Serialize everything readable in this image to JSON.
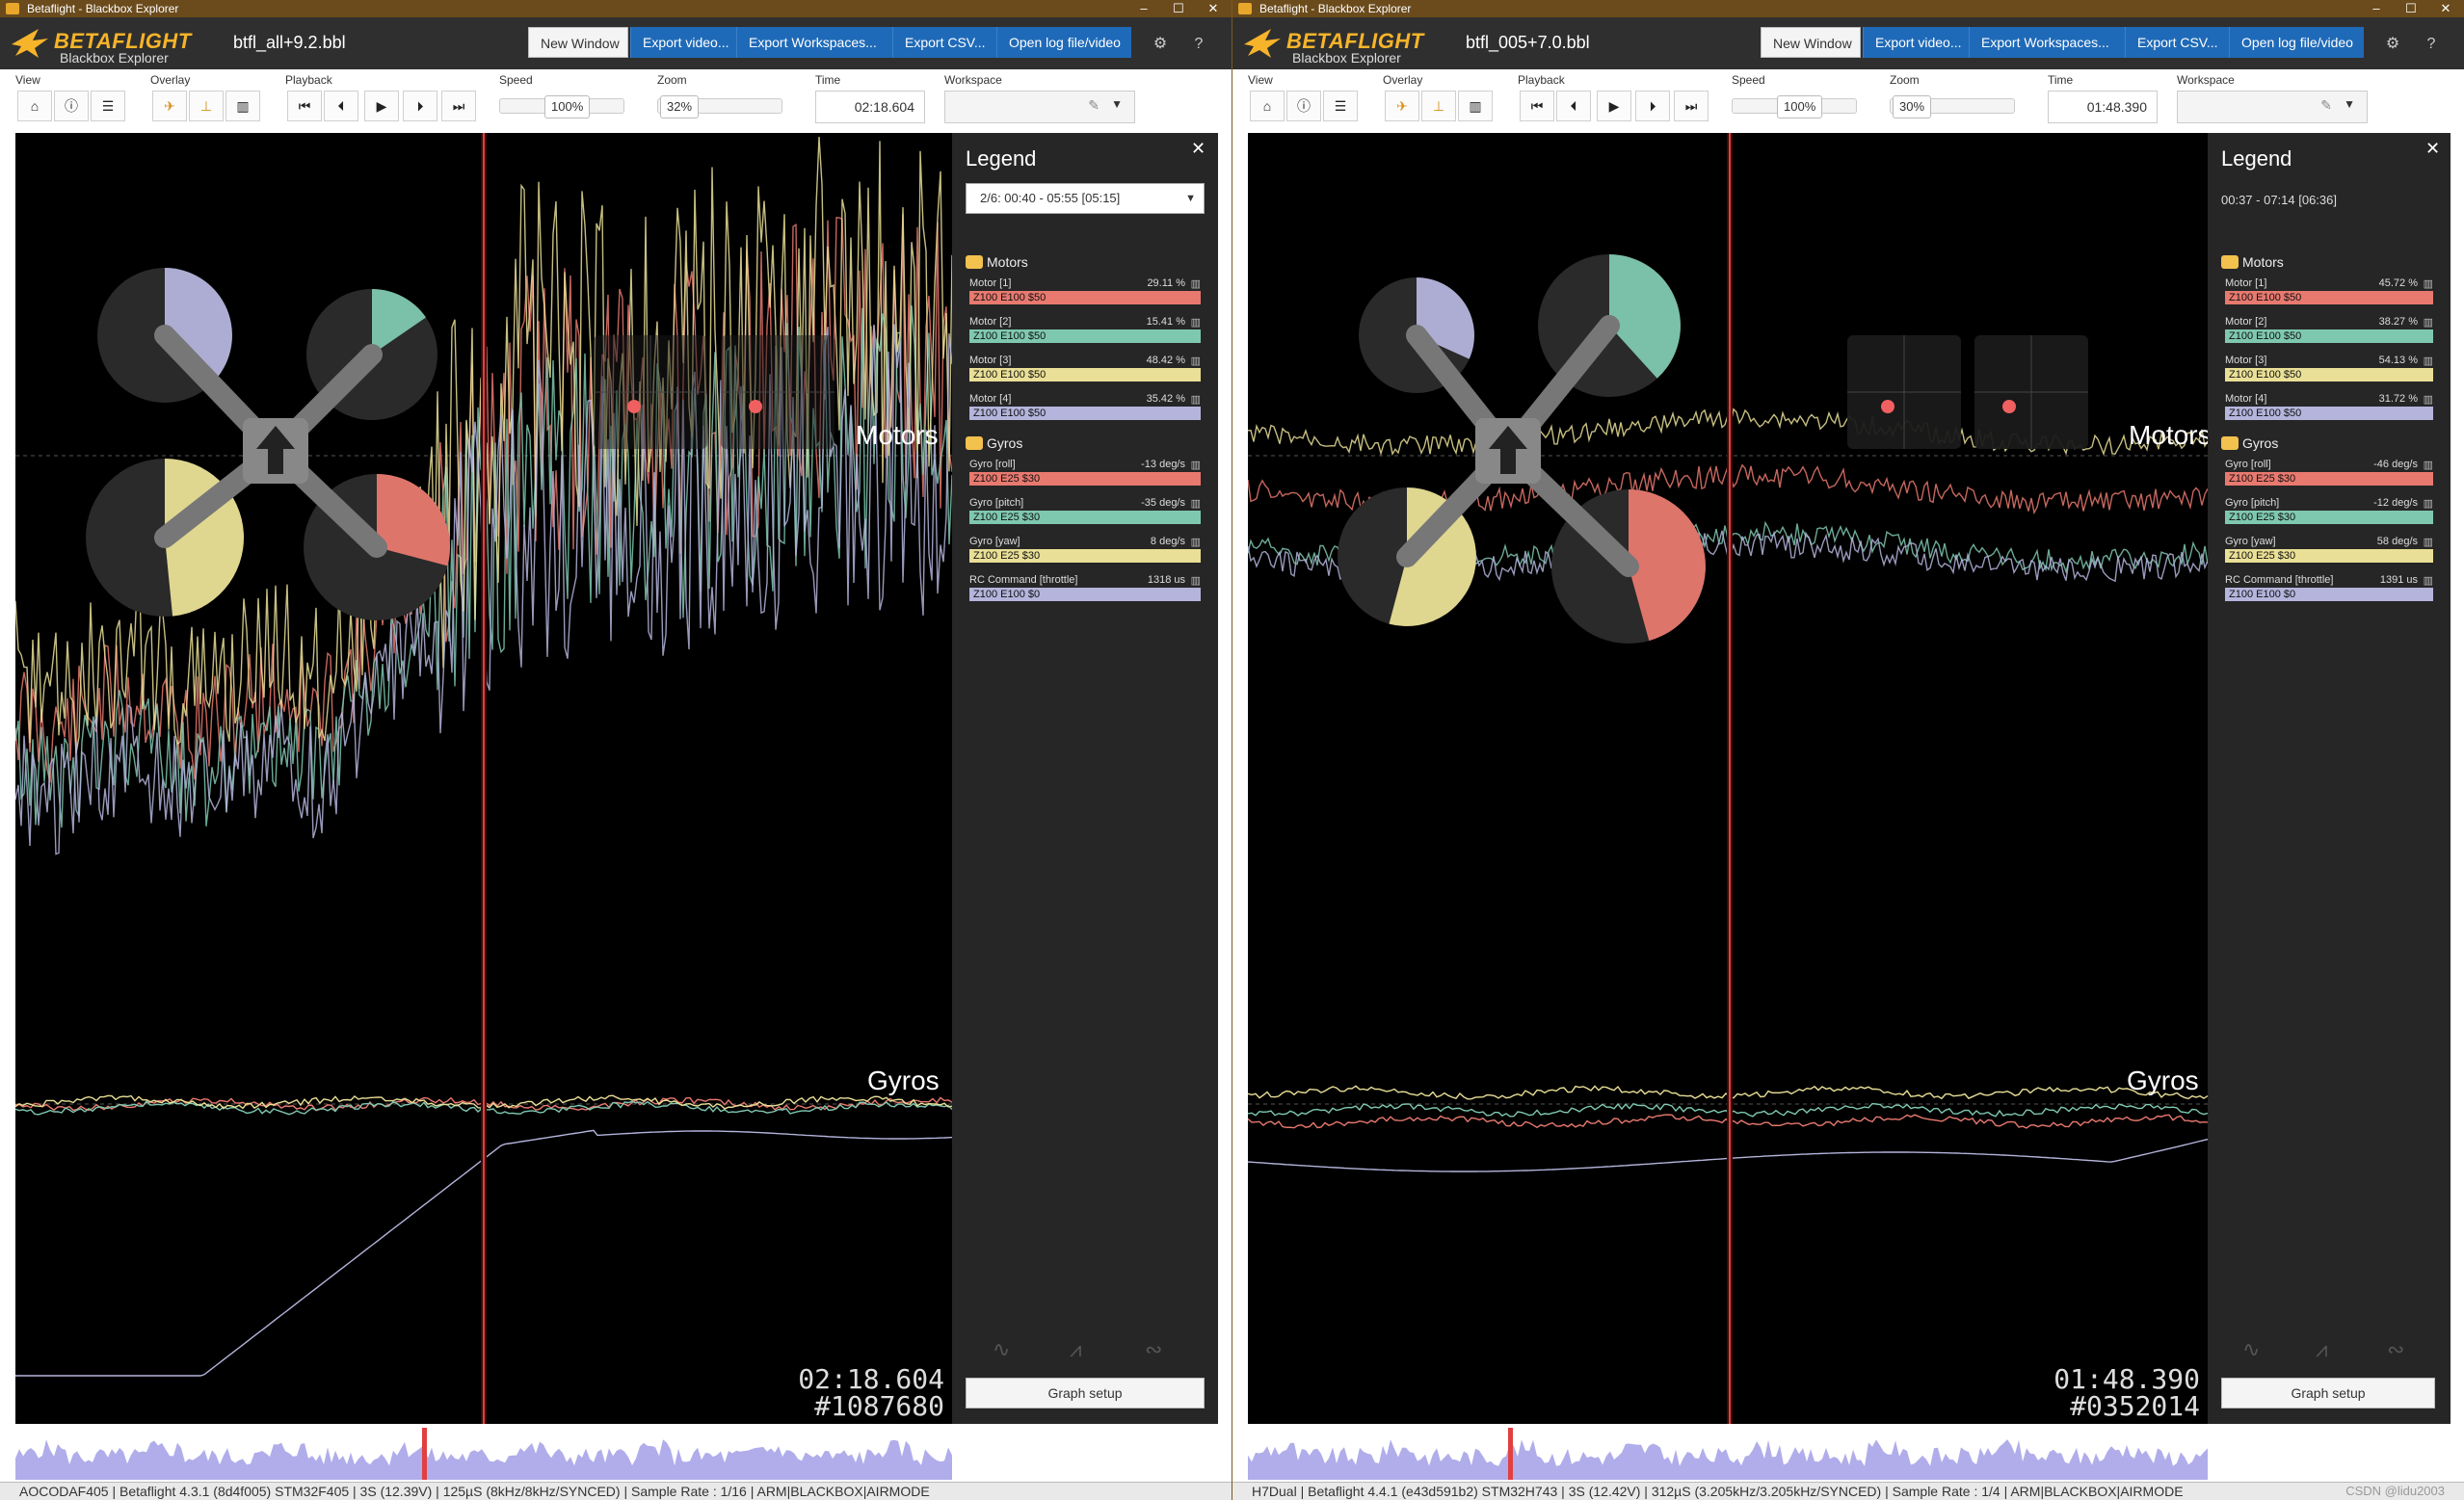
{
  "left": {
    "window_title": "Betaflight - Blackbox Explorer",
    "brand": "BETAFLIGHT",
    "brand_sub": "Blackbox Explorer",
    "filename": "btfl_all+9.2.bbl",
    "header_buttons": [
      "New Window",
      "Export video...",
      "Export Workspaces...",
      "Export CSV...",
      "Open log file/video"
    ],
    "toolbar_labels": {
      "view": "View",
      "overlay": "Overlay",
      "playback": "Playback",
      "speed": "Speed",
      "zoom": "Zoom",
      "time": "Time",
      "workspace": "Workspace"
    },
    "speed": "100%",
    "speed_fraction": 1.0,
    "zoom": "32%",
    "zoom_fraction": 0.32,
    "time": "02:18.604",
    "graph_labels": {
      "motors": "Motors",
      "gyros": "Gyros"
    },
    "time_overlay": "02:18.604",
    "frame_overlay": "#1087680",
    "legend": {
      "title": "Legend",
      "log_select": "2/6: 00:40 - 05:55 [05:15]",
      "groups": [
        {
          "name": "Motors",
          "fields": [
            {
              "name": "Motor [1]",
              "value": "29.11 %",
              "setting": "Z100 E100 $50",
              "color": "#e8796f"
            },
            {
              "name": "Motor [2]",
              "value": "15.41 %",
              "setting": "Z100 E100 $50",
              "color": "#7fc8b0"
            },
            {
              "name": "Motor [3]",
              "value": "48.42 %",
              "setting": "Z100 E100 $50",
              "color": "#e9df96"
            },
            {
              "name": "Motor [4]",
              "value": "35.42 %",
              "setting": "Z100 E100 $50",
              "color": "#b4b4dc"
            }
          ]
        },
        {
          "name": "Gyros",
          "fields": [
            {
              "name": "Gyro [roll]",
              "value": "-13 deg/s",
              "setting": "Z100 E25 $30",
              "color": "#e8796f"
            },
            {
              "name": "Gyro [pitch]",
              "value": "-35 deg/s",
              "setting": "Z100 E25 $30",
              "color": "#7fc8b0"
            },
            {
              "name": "Gyro [yaw]",
              "value": "8 deg/s",
              "setting": "Z100 E25 $30",
              "color": "#e9df96"
            },
            {
              "name": "RC Command [throttle]",
              "value": "1318 us",
              "setting": "Z100 E100 $0",
              "color": "#b4b4dc"
            }
          ]
        }
      ],
      "graph_setup": "Graph setup"
    },
    "motor_levels": [
      0.2911,
      0.1541,
      0.4842,
      0.3542
    ],
    "statusbar": "AOCODAF405  |  Betaflight 4.3.1 (8d4f005) STM32F405  |  3S (12.39V)  |  125µS (8kHz/8kHz/SYNCED)  |  Sample Rate : 1/16  |  ARM|BLACKBOX|AIRMODE"
  },
  "right": {
    "window_title": "Betaflight - Blackbox Explorer",
    "brand": "BETAFLIGHT",
    "brand_sub": "Blackbox Explorer",
    "filename": "btfl_005+7.0.bbl",
    "header_buttons": [
      "New Window",
      "Export video...",
      "Export Workspaces...",
      "Export CSV...",
      "Open log file/video"
    ],
    "toolbar_labels": {
      "view": "View",
      "overlay": "Overlay",
      "playback": "Playback",
      "speed": "Speed",
      "zoom": "Zoom",
      "time": "Time",
      "workspace": "Workspace"
    },
    "speed": "100%",
    "speed_fraction": 1.0,
    "zoom": "30%",
    "zoom_fraction": 0.3,
    "time": "01:48.390",
    "graph_labels": {
      "motors": "Motors",
      "gyros": "Gyros"
    },
    "time_overlay": "01:48.390",
    "frame_overlay": "#0352014",
    "legend": {
      "title": "Legend",
      "log_range": "00:37 - 07:14 [06:36]",
      "groups": [
        {
          "name": "Motors",
          "fields": [
            {
              "name": "Motor [1]",
              "value": "45.72 %",
              "setting": "Z100 E100 $50",
              "color": "#e8796f"
            },
            {
              "name": "Motor [2]",
              "value": "38.27 %",
              "setting": "Z100 E100 $50",
              "color": "#7fc8b0"
            },
            {
              "name": "Motor [3]",
              "value": "54.13 %",
              "setting": "Z100 E100 $50",
              "color": "#e9df96"
            },
            {
              "name": "Motor [4]",
              "value": "31.72 %",
              "setting": "Z100 E100 $50",
              "color": "#b4b4dc"
            }
          ]
        },
        {
          "name": "Gyros",
          "fields": [
            {
              "name": "Gyro [roll]",
              "value": "-46 deg/s",
              "setting": "Z100 E25 $30",
              "color": "#e8796f"
            },
            {
              "name": "Gyro [pitch]",
              "value": "-12 deg/s",
              "setting": "Z100 E25 $30",
              "color": "#7fc8b0"
            },
            {
              "name": "Gyro [yaw]",
              "value": "58 deg/s",
              "setting": "Z100 E25 $30",
              "color": "#e9df96"
            },
            {
              "name": "RC Command [throttle]",
              "value": "1391 us",
              "setting": "Z100 E100 $0",
              "color": "#b4b4dc"
            }
          ]
        }
      ],
      "graph_setup": "Graph setup"
    },
    "motor_levels": [
      0.4572,
      0.3827,
      0.5413,
      0.3172
    ],
    "statusbar": "H7Dual  |  Betaflight 4.4.1 (e43d591b2) STM32H743  |  3S (12.42V)  |  312µS (3.205kHz/3.205kHz/SYNCED)  |  Sample Rate : 1/4  |  ARM|BLACKBOX|AIRMODE"
  },
  "watermark": "CSDN @lidu2003",
  "icons": {
    "view": [
      "home-icon",
      "info-icon",
      "table-icon"
    ],
    "overlay": [
      "craft-icon",
      "sticks-icon",
      "analyser-icon"
    ],
    "playback": [
      "skip-start-icon",
      "step-back-icon",
      "play-icon",
      "step-forward-icon",
      "skip-end-icon"
    ],
    "header": [
      "gear-icon",
      "help-icon"
    ]
  },
  "colors": {
    "motor1": "#e8796f",
    "motor2": "#7fc8b0",
    "motor3": "#e9df96",
    "motor4": "#b4b4dc",
    "accent": "#1f6ab8",
    "brand": "#f6b42a",
    "cursor": "#e04040"
  }
}
